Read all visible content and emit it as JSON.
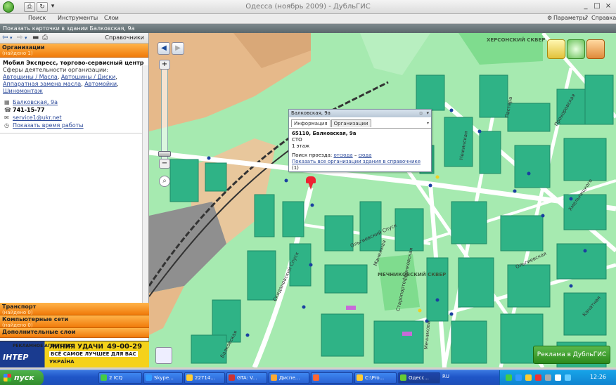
{
  "window": {
    "title": "Одесса (ноябрь 2009) - ДубльГИС",
    "min": "_",
    "max": "□",
    "close": "×"
  },
  "menu": {
    "items": [
      "Поиск",
      "Инструменты",
      "Слои"
    ],
    "params": "Параметры",
    "help": "Справка"
  },
  "context_bar": "Показать карточки в здании Балковская, 9а",
  "left_panel": {
    "directory_label": "Справочники",
    "organizations_header": "Организации",
    "organizations_found": "(найдено 1)",
    "org": {
      "name": "Мобил Экспресс, торгово-сервисный центр",
      "activity_label": "Сферы деятельности организации:",
      "rubrics": [
        "Автошины / Масла",
        "Автошины / Диски",
        "Аппаратная замена масла",
        "Автомойки",
        "Шиномонтаж"
      ],
      "address": "Балковская, 9а",
      "phone": "741-15-77",
      "email": "service1@ukr.net",
      "hours_link": "Показать время работы"
    },
    "sections": [
      {
        "title": "Транспорт",
        "found": "(найдено 0)"
      },
      {
        "title": "Компьютерные сети",
        "found": "(найдено 0)"
      },
      {
        "title": "Дополнительные слои",
        "found": ""
      }
    ]
  },
  "ad_banner": {
    "agency": "РЕКЛАМНОЕ АГЕНТСТВО",
    "name": "ЛИНИЯ УДАЧИ",
    "phone": "49-00-29",
    "slogan": "ВСЁ САМОЕ ЛУЧШЕЕ ДЛЯ ВАС",
    "tv": "ІНТЕР",
    "tv2": "УКРАЇНА"
  },
  "map": {
    "labels": [
      "ХЕРСОНСКИЙ СКВЕР",
      "МЕЧНИКОВСКИЙ СКВЕР"
    ],
    "streets": [
      "Балковская",
      "Мечникова",
      "Пастера",
      "Ольгиевский Спуск",
      "Манежная",
      "Нежинская",
      "Ольгиевская",
      "Канатная",
      "Скидановский Спуск",
      "Старопортофранковская",
      "Прохоровская",
      "Хмельницкого"
    ],
    "colors": {
      "building": "#2fb386",
      "building_dark": "#1f8a66",
      "ground": "#a6eab0",
      "industrial": "#e6b98a",
      "road": "#ffffff",
      "rail": "#333333",
      "stop": "#1a3fa0"
    }
  },
  "popup": {
    "title": "Балковская, 9а",
    "tabs": [
      "Информация",
      "Организации"
    ],
    "address": "65110, Балковская, 9а",
    "type": "СТО",
    "floors": "1 этаж",
    "route_label": "Поиск проезда:",
    "route_from": "отсюда",
    "route_sep": "–",
    "route_to": "сюда",
    "show_all": "Показать все организации здания в справочнике",
    "show_all_count": "(1)"
  },
  "ad_button": "Реклама в ДубльГИС",
  "taskbar": {
    "start": "пуск",
    "tasks": [
      "2 ICQ",
      "Skype...",
      "22714...",
      "GTA: V...",
      "Диспе...",
      "",
      "С:\\Pro...",
      "Одесс..."
    ],
    "lang": "RU",
    "clock": "12:26"
  }
}
